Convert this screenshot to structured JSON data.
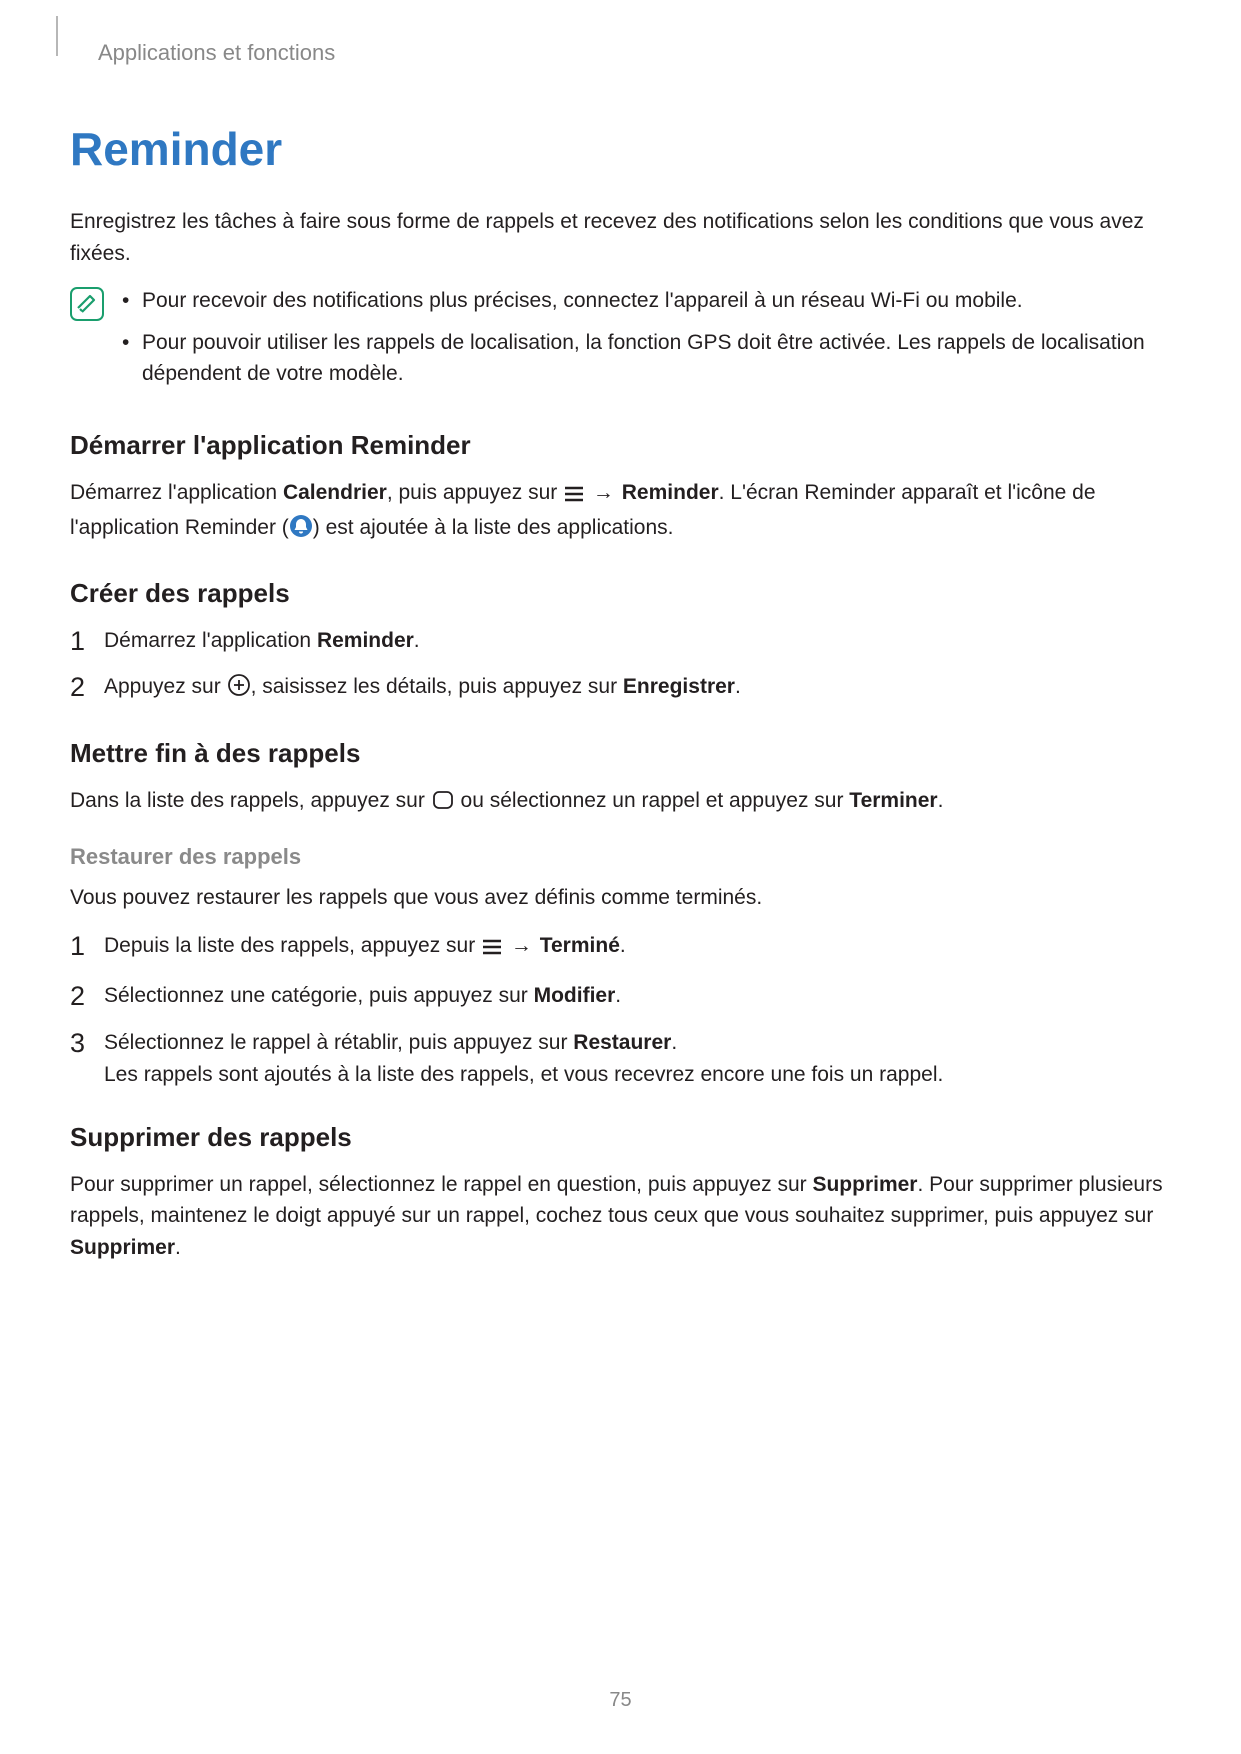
{
  "header": {
    "section": "Applications et fonctions"
  },
  "title": "Reminder",
  "intro": "Enregistrez les tâches à faire sous forme de rappels et recevez des notifications selon les conditions que vous avez fixées.",
  "notes": [
    "Pour recevoir des notifications plus précises, connectez l'appareil à un réseau Wi-Fi ou mobile.",
    "Pour pouvoir utiliser les rappels de localisation, la fonction GPS doit être activée. Les rappels de localisation dépendent de votre modèle."
  ],
  "start": {
    "heading": "Démarrer l'application Reminder",
    "p1a": "Démarrez l'application ",
    "calendar_bold": "Calendrier",
    "p1b": ", puis appuyez sur ",
    "arrow": "→",
    "reminder_bold": "Reminder",
    "p1c": ". L'écran Reminder apparaît et l'icône de l'application Reminder (",
    "p1d": ") est ajoutée à la liste des applications."
  },
  "create": {
    "heading": "Créer des rappels",
    "step1_a": "Démarrez l'application ",
    "step1_b": "Reminder",
    "step1_c": ".",
    "step2_a": "Appuyez sur ",
    "step2_b": ", saisissez les détails, puis appuyez sur ",
    "step2_c": "Enregistrer",
    "step2_d": "."
  },
  "finish": {
    "heading": "Mettre fin à des rappels",
    "p_a": "Dans la liste des rappels, appuyez sur ",
    "p_b": " ou sélectionnez un rappel et appuyez sur ",
    "p_c": "Terminer",
    "p_d": "."
  },
  "restore": {
    "heading": "Restaurer des rappels",
    "intro": "Vous pouvez restaurer les rappels que vous avez définis comme terminés.",
    "s1_a": "Depuis la liste des rappels, appuyez sur ",
    "s1_arrow": "→",
    "s1_bold": "Terminé",
    "s1_c": ".",
    "s2_a": "Sélectionnez une catégorie, puis appuyez sur ",
    "s2_bold": "Modifier",
    "s2_c": ".",
    "s3_a": "Sélectionnez le rappel à rétablir, puis appuyez sur ",
    "s3_bold": "Restaurer",
    "s3_c": ".",
    "s3_note": "Les rappels sont ajoutés à la liste des rappels, et vous recevrez encore une fois un rappel."
  },
  "delete": {
    "heading": "Supprimer des rappels",
    "p_a": "Pour supprimer un rappel, sélectionnez le rappel en question, puis appuyez sur ",
    "p_b": "Supprimer",
    "p_c": ". Pour supprimer plusieurs rappels, maintenez le doigt appuyé sur un rappel, cochez tous ceux que vous souhaitez supprimer, puis appuyez sur ",
    "p_d": "Supprimer",
    "p_e": "."
  },
  "page_number": "75"
}
